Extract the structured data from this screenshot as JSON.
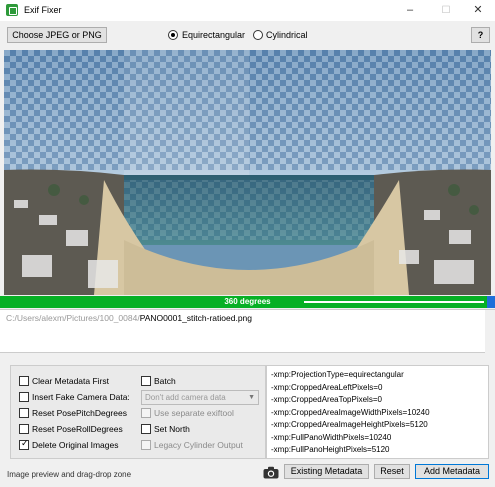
{
  "window": {
    "title": "Exif Fixer",
    "controls": {
      "minimize": "–",
      "maximize": "☐",
      "close": "✕"
    }
  },
  "toolbar": {
    "choose_label": "Choose JPEG or PNG",
    "projection_options": [
      {
        "label": "Equirectangular",
        "selected": true
      },
      {
        "label": "Cylindrical",
        "selected": false
      }
    ],
    "help_label": "?"
  },
  "progress": {
    "text": "360 degrees",
    "value_percent": 100
  },
  "file": {
    "path_prefix": "C:/Users/alexm/Pictures/100_0084/",
    "file_name": "PANO0001_stitch-ratioed.png"
  },
  "options": {
    "clear_metadata": {
      "label": "Clear Metadata First",
      "checked": false
    },
    "insert_fake_camera": {
      "label": "Insert Fake Camera Data:",
      "checked": false
    },
    "reset_pitch": {
      "label": "Reset PosePitchDegrees",
      "checked": false
    },
    "reset_roll": {
      "label": "Reset PoseRollDegrees",
      "checked": false
    },
    "delete_originals": {
      "label": "Delete Original Images",
      "checked": true
    },
    "batch": {
      "label": "Batch",
      "checked": false
    },
    "camera_dropdown": {
      "value": "Don't add camera data"
    },
    "separate_exiftool": {
      "label": "Use separate exiftool",
      "checked": false,
      "disabled": true
    },
    "set_north": {
      "label": "Set North",
      "checked": false
    },
    "legacy_cylinder": {
      "label": "Legacy Cylinder Output",
      "checked": false,
      "disabled": true
    }
  },
  "xmp_lines": [
    "-xmp:ProjectionType=equirectangular",
    "-xmp:CroppedAreaLeftPixels=0",
    "-xmp:CroppedAreaTopPixels=0",
    "-xmp:CroppedAreaImageWidthPixels=10240",
    "-xmp:CroppedAreaImageHeightPixels=5120",
    "-xmp:FullPanoWidthPixels=10240",
    "-xmp:FullPanoHeightPixels=5120"
  ],
  "footer": {
    "status_text": "Image preview and drag-drop zone",
    "existing_metadata_label": "Existing Metadata",
    "reset_label": "Reset",
    "add_metadata_label": "Add Metadata"
  },
  "colors": {
    "progress_green": "#06b025",
    "accent_blue": "#0078d7"
  }
}
